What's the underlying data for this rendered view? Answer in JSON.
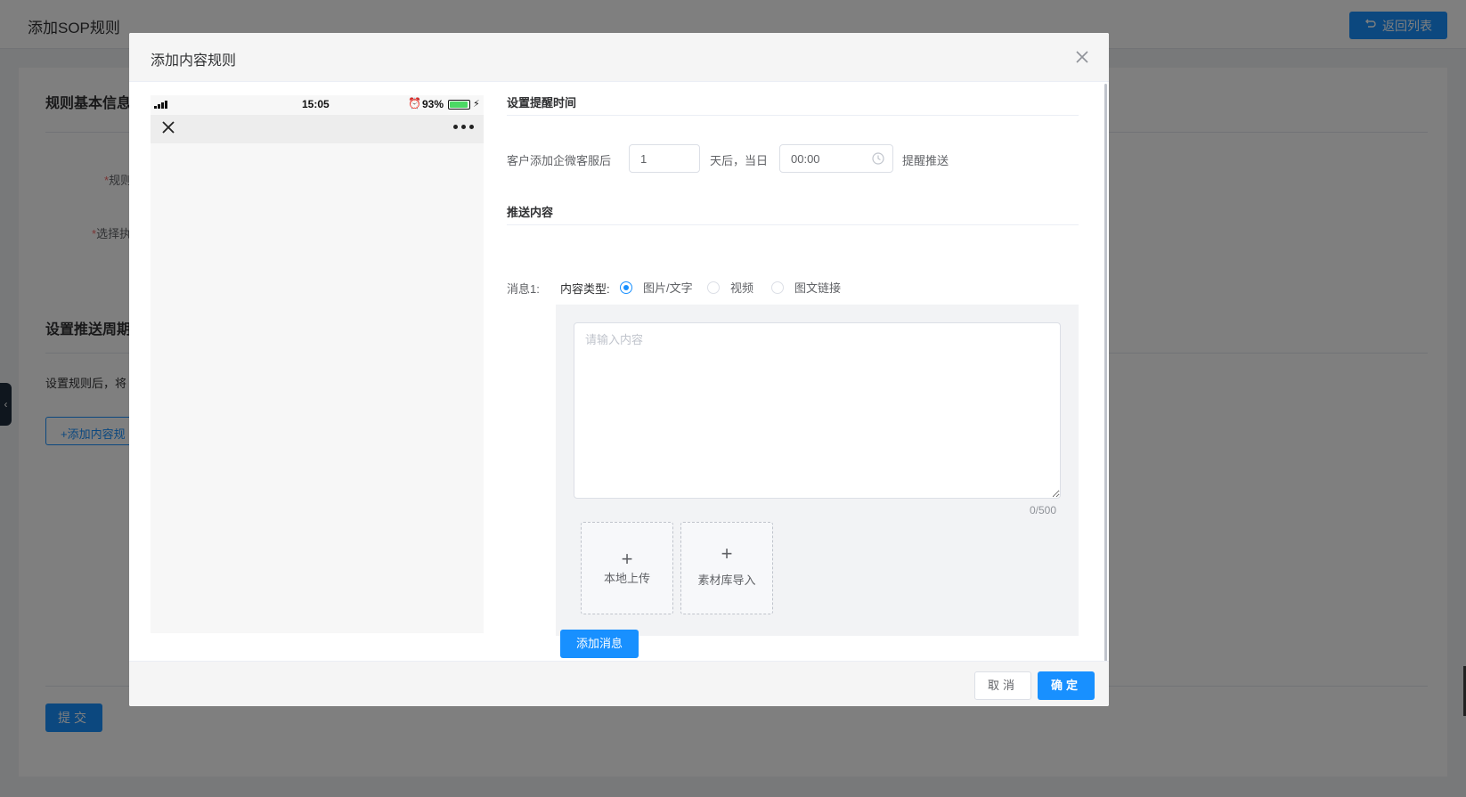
{
  "page": {
    "title": "添加SOP规则",
    "back_label": "返回列表",
    "section_basic": "规则基本信息",
    "field_rule_name": "规则",
    "field_select": "选择执",
    "section_cycle": "设置推送周期",
    "hint_text": "设置规则后，将",
    "add_rule_label": "+添加内容规",
    "submit_label": "提交",
    "required_mark": "*"
  },
  "dialog": {
    "title": "添加内容规则",
    "phone": {
      "time": "15:05",
      "alarm": "⏰",
      "battery_text": "93%",
      "battery_level": 0.93,
      "bolt": "⚡"
    },
    "reminder": {
      "section_title": "设置提醒时间",
      "prefix": "客户添加企微客服后",
      "days_value": "1",
      "middle": "天后，当日",
      "time_value": "00:00",
      "suffix": "提醒推送"
    },
    "content": {
      "section_title": "推送内容",
      "message_label": "消息1:",
      "type_label": "内容类型:",
      "types": [
        "图片/文字",
        "视频",
        "图文链接"
      ],
      "selected_type": "图片/文字",
      "textarea_placeholder": "请输入内容",
      "counter": "0/500",
      "upload_local": "本地上传",
      "upload_library": "素材库导入"
    },
    "add_message_label": "添加消息",
    "cancel_label": "取消",
    "ok_label": "确定"
  },
  "colors": {
    "primary": "#1890ff",
    "overlay": "rgba(0,0,0,0.5)"
  }
}
